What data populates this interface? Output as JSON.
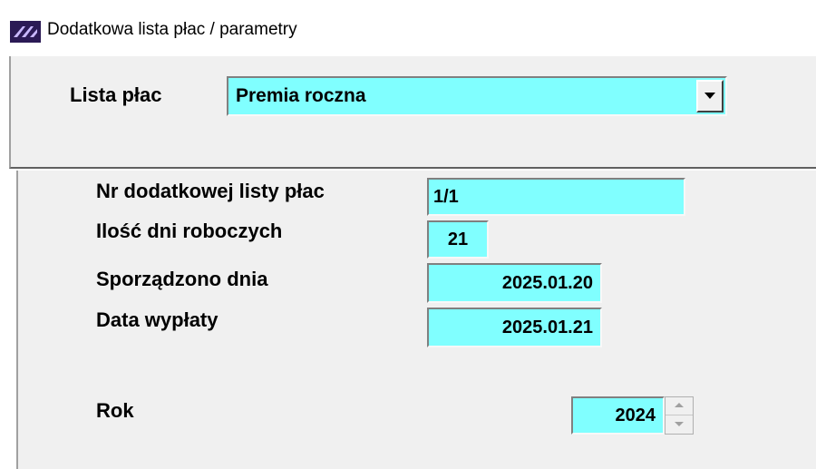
{
  "window": {
    "title": "Dodatkowa lista płac / parametry",
    "icon": "app-icon"
  },
  "payroll_list": {
    "label": "Lista płac",
    "selected": "Premia roczna"
  },
  "form": {
    "list_number": {
      "label": "Nr dodatkowej listy płac",
      "value": "1/1"
    },
    "working_days": {
      "label": "Ilość dni roboczych",
      "value": "21"
    },
    "prepared_on": {
      "label": "Sporządzono dnia",
      "value": "2025.01.20"
    },
    "payment_date": {
      "label": "Data wypłaty",
      "value": "2025.01.21"
    },
    "year": {
      "label": "Rok",
      "value": "2024"
    }
  },
  "colors": {
    "field_background": "#80ffff",
    "panel_background": "#f0f0f0"
  }
}
